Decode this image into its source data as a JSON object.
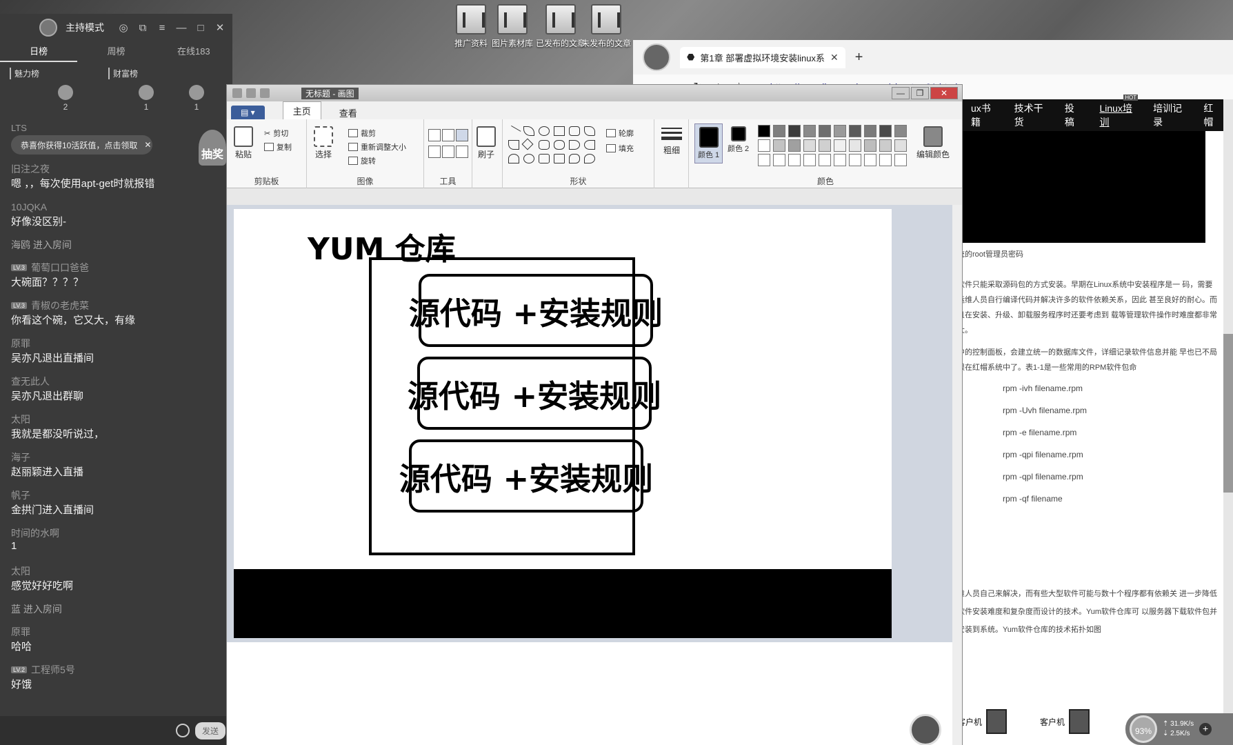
{
  "desktop": {
    "icons": [
      {
        "label": "推广资料"
      },
      {
        "label": "图片素材库"
      },
      {
        "label": "已发布的文章"
      },
      {
        "label": "未发布的文章"
      }
    ]
  },
  "chat": {
    "title": "主持模式",
    "controls": [
      "◎",
      "⧉",
      "≡",
      "—",
      "□",
      "✕"
    ],
    "tabs": [
      "日榜",
      "周榜",
      "在线183"
    ],
    "ranks": [
      "魅力榜",
      "财富榜"
    ],
    "top3": [
      "2",
      "1",
      "1"
    ],
    "partial_name": "LTS",
    "notice": "恭喜你获得10活跃值，点击领取",
    "notice_close": "✕",
    "draw_badge": "抽奖",
    "messages": [
      {
        "user": "旧注之夜",
        "level": "",
        "text": "嗯 ，，每次使用apt-get时就报错"
      },
      {
        "user": "10JQKA",
        "level": "",
        "text": "好像没区别-"
      },
      {
        "user": "海鸥 进入房间",
        "level": "",
        "text": ""
      },
      {
        "user": "葡萄口口爸爸",
        "level": "LV.3",
        "text": "大碗面？？？？"
      },
      {
        "user": "青椒の老虎菜",
        "level": "LV.3",
        "text": "你看这个碗，它又大，有缘"
      },
      {
        "user": "原罪",
        "level": "",
        "text": "吴亦凡退出直播间"
      },
      {
        "user": "查无此人",
        "level": "",
        "text": "吴亦凡退出群聊"
      },
      {
        "user": "太阳",
        "level": "",
        "text": "我就是都没听说过，"
      },
      {
        "user": "海子",
        "level": "",
        "text": "赵丽颖进入直播"
      },
      {
        "user": "帆子",
        "level": "",
        "text": "金拱门进入直播间"
      },
      {
        "user": "时间的水啊",
        "level": "",
        "text": "1"
      },
      {
        "user": "太阳",
        "level": "",
        "text": "感觉好好吃啊"
      },
      {
        "user": "蓝 进入房间",
        "level": "",
        "text": ""
      },
      {
        "user": "原罪",
        "level": "",
        "text": "哈哈"
      },
      {
        "user": "工程师5号",
        "level": "LV.2",
        "text": "好饿"
      }
    ],
    "send_label": "发送"
  },
  "browser": {
    "tab_title": "第1章 部署虚拟环境安装linux系",
    "tab_close": "✕",
    "new_tab": "+",
    "nav": [
      "‹",
      "↻",
      "⌂",
      "☆"
    ],
    "url_scheme": "https://",
    "url_host": "www.linuxprobe.com",
    "url_path": "/chapter-01.html",
    "site_nav": [
      "ux书籍",
      "技术干货",
      "投稿",
      "Linux培训",
      "培训记录",
      "红帽"
    ],
    "site_nav_hot": "HOT",
    "para0": "统的root管理员密码",
    "para1": "软件只能采取源码包的方式安装。早期在Linux系统中安装程序是一 码，需要运维人员自行编译代码并解决许多的软件依赖关系，因此 甚至良好的耐心。而且在安装、升级、卸载服务程序时还要考虑到 载等管理软件操作时难度都非常大。",
    "para2": "中的控制面板，会建立统一的数据库文件，详细记录软件信息并能 早也已不局限在红帽系统中了。表1-1是一些常用的RPM软件包命",
    "rpm_commands": [
      "rpm -ivh filename.rpm",
      "rpm -Uvh filename.rpm",
      "rpm -e filename.rpm",
      "rpm -qpi filename.rpm",
      "rpm -qpl filename.rpm",
      "rpm -qf filename"
    ],
    "para3": "维人员自己来解决，而有些大型软件可能与数十个程序都有依赖关 进一步降低软件安装难度和复杂度而设计的技术。Yum软件仓库可 以服务器下载软件包并安装到系统。Yum软件仓库的技术拓扑如图",
    "diagram_labels": [
      "客户机",
      "客户机"
    ]
  },
  "paint": {
    "title": "无标题 - 画图",
    "window_controls": [
      "—",
      "❐",
      "✕"
    ],
    "file_menu": "▤ ▾",
    "tabs": [
      "主页",
      "查看"
    ],
    "clipboard": {
      "paste": "粘贴",
      "cut": "剪切",
      "copy": "复制",
      "label": "剪贴板"
    },
    "image": {
      "select": "选择",
      "crop": "裁剪",
      "resize": "重新调整大小",
      "rotate": "旋转",
      "label": "图像"
    },
    "tools": {
      "label": "工具"
    },
    "brushes": "刷子",
    "shapes": {
      "outline": "轮廓",
      "fill": "填充",
      "label": "形状"
    },
    "size": "粗细",
    "color1": "颜色 1",
    "color2": "颜色 2",
    "edit_colors": "编辑颜色",
    "colors_label": "颜色",
    "palette_top": [
      "#000000",
      "#7f7f7f",
      "#3c3c3c",
      "#8a8a8a",
      "#6e6e6e",
      "#9a9a9a",
      "#5a5a5a",
      "#7a7a7a",
      "#4a4a4a",
      "#888888"
    ],
    "palette_mid": [
      "#ffffff",
      "#c3c3c3",
      "#a0a0a0",
      "#dcdcdc",
      "#d0d0d0",
      "#f0f0f0",
      "#e6e6e6",
      "#bdbdbd",
      "#cccccc",
      "#e0e0e0"
    ],
    "canvas": {
      "title": "YUM 仓库",
      "boxes": [
        "源代码 +安装规则",
        "源代码 +安装规则",
        "源代码 +安装规则"
      ]
    }
  },
  "tray": {
    "percent": "93%",
    "up": "31.9K/s",
    "down": "2.5K/s",
    "plus": "+"
  }
}
